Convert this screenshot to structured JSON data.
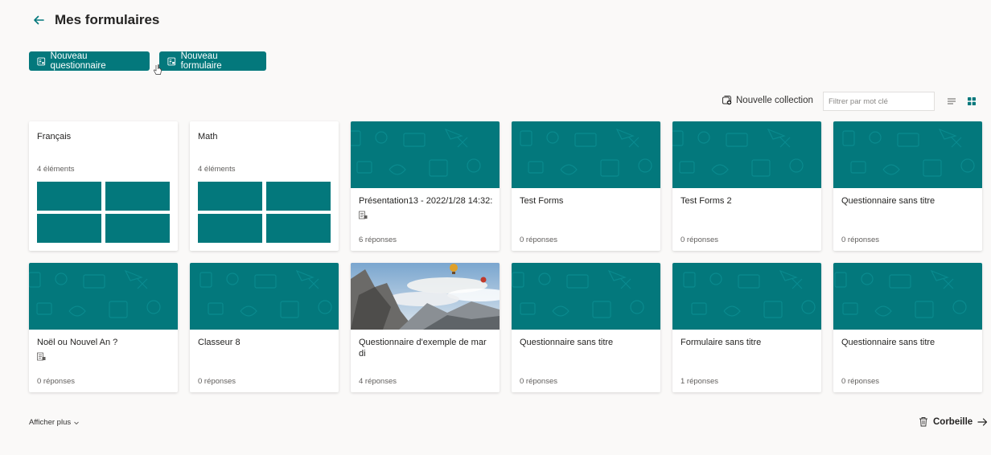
{
  "header": {
    "title": "Mes formulaires",
    "back_icon": "arrow-left-icon"
  },
  "actions": {
    "new_quiz_label": "Nouveau questionnaire",
    "new_form_label": "Nouveau formulaire"
  },
  "toolbar": {
    "new_collection_label": "Nouvelle collection",
    "filter_placeholder": "Filtrer par mot clé"
  },
  "collections": [
    {
      "title": "Français",
      "count": "4 éléments"
    },
    {
      "title": "Math",
      "count": "4 éléments"
    }
  ],
  "forms": [
    {
      "title": "Présentation13 - 2022/1/28 14:32:",
      "responses": "6 réponses",
      "quiz_icon": true
    },
    {
      "title": "Test Forms",
      "responses": "0 réponses"
    },
    {
      "title": "Test Forms 2",
      "responses": "0 réponses"
    },
    {
      "title": "Questionnaire sans titre",
      "responses": "0 réponses"
    },
    {
      "title": "Noël ou Nouvel An ?",
      "responses": "0 réponses",
      "quiz_icon": true
    },
    {
      "title": "Classeur 8",
      "responses": "0 réponses"
    },
    {
      "title": "Questionnaire d'exemple de mar di",
      "responses": "4 réponses",
      "photo": true
    },
    {
      "title": "Questionnaire sans titre",
      "responses": "0 réponses"
    },
    {
      "title": "Formulaire sans titre",
      "responses": "1 réponses"
    },
    {
      "title": "Questionnaire sans titre",
      "responses": "0 réponses"
    }
  ],
  "footer": {
    "show_more_label": "Afficher plus",
    "trash_label": "Corbeille"
  },
  "colors": {
    "accent": "#03787c",
    "background": "#faf9f8"
  }
}
